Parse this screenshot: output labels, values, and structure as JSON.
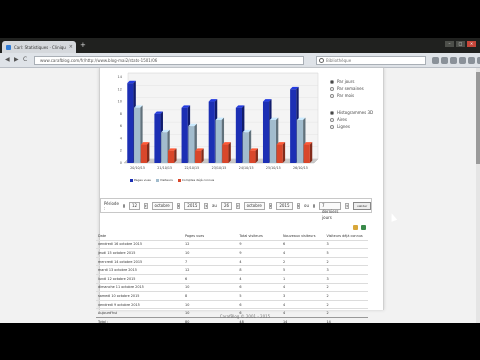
{
  "browser": {
    "tab_title": "Carl: Statistiques · Clinique",
    "url": "www.carafblog.com/fr/http://www.blog-mai2/stats-1501/06",
    "search_placeholder": "Bibliothèque",
    "back_label": "◀",
    "forward_label": "▶",
    "reload_label": "C",
    "minimize_label": "–",
    "maximize_label": "□",
    "close_label": "✕",
    "new_tab_label": "+",
    "tab_close_label": "×"
  },
  "chart_data": {
    "type": "bar",
    "categories": [
      "20/10/15",
      "21/10/15",
      "22/10/15",
      "23/10/15",
      "24/10/15",
      "25/10/15",
      "26/10/15"
    ],
    "series": [
      {
        "name": "Pages vues",
        "values": [
          13,
          8,
          9,
          10,
          9,
          10,
          12
        ],
        "color": "#1c2fb4"
      },
      {
        "name": "Visiteurs",
        "values": [
          9,
          5,
          6,
          7,
          5,
          7,
          7
        ],
        "color": "#a2bccd"
      },
      {
        "name": "Comptes déjà connus",
        "values": [
          3,
          2,
          2,
          3,
          2,
          3,
          3
        ],
        "color": "#d9472b"
      }
    ],
    "ylim": [
      0,
      14
    ],
    "yticks": [
      0,
      2,
      4,
      6,
      8,
      10,
      12,
      14
    ],
    "legend_position": "bottom",
    "grid": true
  },
  "chart_options": {
    "grouping": [
      {
        "label": "Par jours",
        "checked": true
      },
      {
        "label": "Par semaines",
        "checked": false
      },
      {
        "label": "Par mois",
        "checked": false
      }
    ],
    "display": [
      {
        "label": "Histogrammes 3D",
        "checked": true
      },
      {
        "label": "Aires",
        "checked": false
      },
      {
        "label": "Lignes",
        "checked": false
      }
    ]
  },
  "period": {
    "label": "Période :",
    "from_day": "12",
    "from_month": "octobre",
    "from_year": "2015",
    "to_label": "au",
    "to_day": "26",
    "to_month": "octobre",
    "to_year": "2015",
    "or_label": "ou",
    "last_days": "7 derniers jours",
    "go_label": "valider"
  },
  "stats_table": {
    "headers": [
      "Date",
      "Pages vues",
      "Total visiteurs",
      "Nouveaux visiteurs",
      "Visiteurs déjà connus"
    ],
    "rows": [
      [
        "vendredi 16 octobre 2015",
        "12",
        "9",
        "6",
        "3"
      ],
      [
        "jeudi 15 octobre 2015",
        "10",
        "9",
        "4",
        "5"
      ],
      [
        "mercredi 14 octobre 2015",
        "7",
        "4",
        "2",
        "2"
      ],
      [
        "mardi 13 octobre 2015",
        "12",
        "8",
        "5",
        "3"
      ],
      [
        "lundi 12 octobre 2015",
        "6",
        "4",
        "1",
        "3"
      ],
      [
        "dimanche 11 octobre 2015",
        "10",
        "6",
        "4",
        "2"
      ],
      [
        "samedi 10 octobre 2015",
        "8",
        "5",
        "3",
        "2"
      ],
      [
        "vendredi 9 octobre 2015",
        "10",
        "6",
        "4",
        "2"
      ],
      [
        "Aujourd'hui",
        "10",
        "6",
        "4",
        "2"
      ]
    ],
    "total": [
      "Total :",
      "80",
      "48",
      "14",
      "14"
    ]
  },
  "footer": "CarafBlog © 2001 - 2015"
}
